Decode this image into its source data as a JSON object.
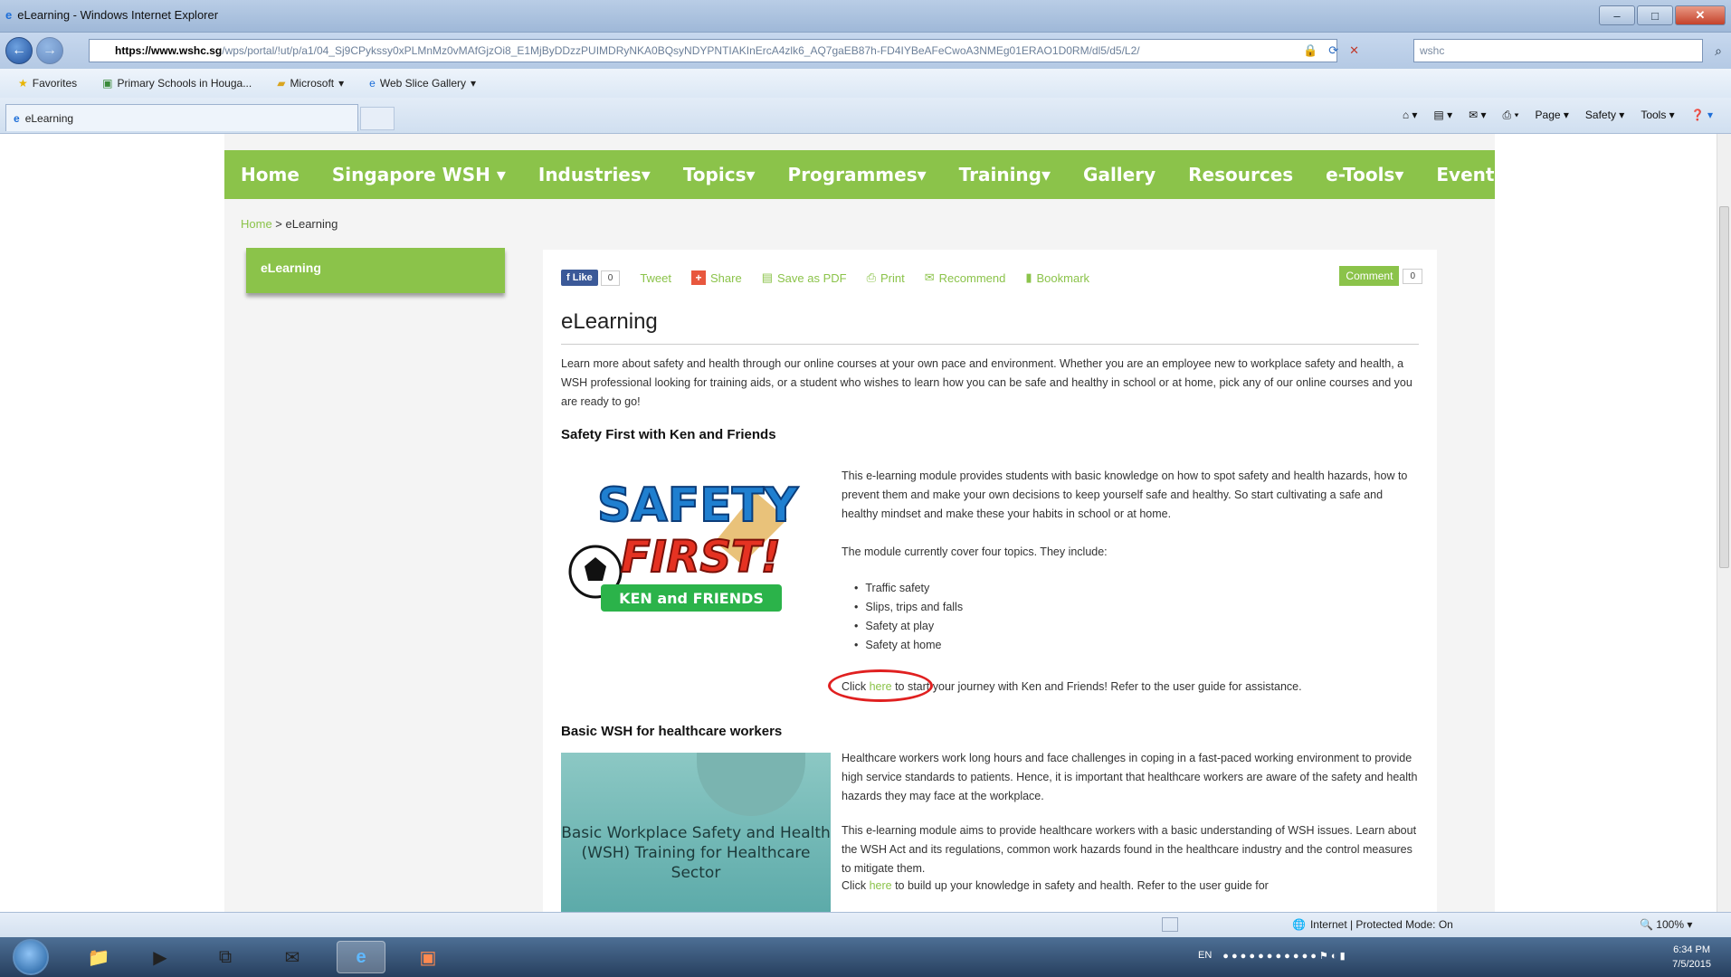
{
  "browser": {
    "window_title": "eLearning - Windows Internet Explorer",
    "address_domain": "https://www.wshc.sg",
    "address_rest": "/wps/portal/!ut/p/a1/04_Sj9CPykssy0xPLMnMz0vMAfGjzOi8_E1MjByDDzzPUIMDRyNKA0BQsyNDYPNTIAKInErcA4zlk6_AQ7gaEB87h-FD4IYBeAFeCwoA3NMEg01ERAO1D0RM/dl5/d5/L2/",
    "search_text": "wshc",
    "favorites": [
      "Favorites",
      "Primary Schools in Houga...",
      "Microsoft",
      "Web Slice Gallery"
    ],
    "tab_label": "eLearning",
    "commands": [
      "Page",
      "Safety",
      "Tools"
    ]
  },
  "site": {
    "nav": [
      "Home",
      "Singapore WSH",
      "Industries",
      "Topics",
      "Programmes",
      "Training",
      "Gallery",
      "Resources",
      "e-Tools",
      "Events"
    ],
    "breadcrumb_home": "Home",
    "breadcrumb_sep": " > ",
    "breadcrumb_current": "eLearning",
    "leftnav_label": "eLearning",
    "share": {
      "like": "Like",
      "like_count": "0",
      "tweet": "Tweet",
      "share": "Share",
      "pdf": "Save as PDF",
      "print": "Print",
      "recommend": "Recommend",
      "bookmark": "Bookmark",
      "comment": "Comment",
      "comment_count": "0"
    },
    "title": "eLearning",
    "intro": "Learn more about safety and health through our online courses at your own pace and environment. Whether you are an employee new to workplace safety and health, a WSH professional looking for training aids, or a student who wishes to learn how you can be safe and healthy in school or at home, pick any of our online courses and you are ready to go!",
    "section1": {
      "heading": "Safety First with Ken and Friends",
      "image_line1": "SAFETY",
      "image_line2": "FIRST!",
      "image_line3": "KEN and FRIENDS",
      "p1": "This e-learning module provides students with basic knowledge on how to spot safety and health hazards, how to prevent them and make your own decisions to keep yourself safe and healthy. So start cultivating a safe and healthy mindset and make these your habits in school or at home.",
      "p2": "The module currently cover four topics. They include:",
      "topics": [
        "Traffic safety",
        "Slips, trips and falls",
        "Safety at play",
        "Safety at home"
      ],
      "click_pre": "Click ",
      "click_link": "here",
      "click_post": " to start your journey with Ken and Friends! Refer to the user guide for assistance."
    },
    "section2": {
      "heading": "Basic WSH for healthcare workers",
      "image_caption": "Basic Workplace Safety and Health (WSH) Training for Healthcare Sector",
      "p1": "Healthcare workers work long hours and face challenges in coping in a fast-paced working environment to provide high service standards to patients. Hence, it is important that healthcare workers are aware of the safety and health hazards they may face at the workplace.",
      "p2": "This e-learning module aims to provide healthcare workers with a basic understanding of WSH issues. Learn about the WSH Act and its regulations, common work hazards found in the healthcare industry and the control measures to mitigate them.",
      "p3_pre": "Click ",
      "p3_link": "here",
      "p3_post": " to build up your knowledge in safety and health. Refer to the user guide for"
    }
  },
  "status": {
    "zone": "Internet | Protected Mode: On",
    "zoom": "100%"
  },
  "taskbar": {
    "lang": "EN",
    "time": "6:34 PM",
    "date": "7/5/2015"
  }
}
